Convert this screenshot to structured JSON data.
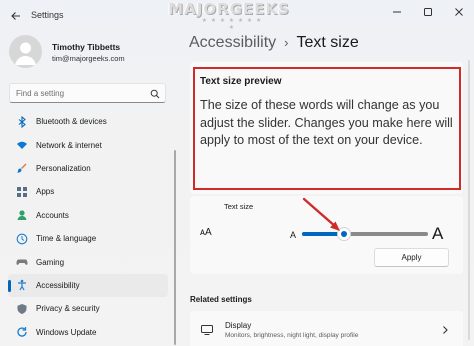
{
  "window": {
    "app_title": "Settings",
    "watermark": "MAJORGEEKS",
    "watermark_stars": "★ ★ ★ ★ ★ ★ ★ ★"
  },
  "profile": {
    "name": "Timothy Tibbetts",
    "email": "tim@majorgeeks.com"
  },
  "search": {
    "placeholder": "Find a setting"
  },
  "sidebar": {
    "items": [
      {
        "label": "Bluetooth & devices",
        "icon": "bluetooth-icon",
        "color": "#0067c0"
      },
      {
        "label": "Network & internet",
        "icon": "wifi-icon",
        "color": "#0a78d4"
      },
      {
        "label": "Personalization",
        "icon": "brush-icon",
        "color": "#e5793d"
      },
      {
        "label": "Apps",
        "icon": "apps-icon",
        "color": "#5a6f86"
      },
      {
        "label": "Accounts",
        "icon": "person-icon",
        "color": "#2fa06b"
      },
      {
        "label": "Time & language",
        "icon": "globe-clock-icon",
        "color": "#1c7fd0"
      },
      {
        "label": "Gaming",
        "icon": "gamepad-icon",
        "color": "#7a7a7a"
      },
      {
        "label": "Accessibility",
        "icon": "accessibility-icon",
        "color": "#1c7fd0",
        "active": true
      },
      {
        "label": "Privacy & security",
        "icon": "shield-icon",
        "color": "#6e7a88"
      },
      {
        "label": "Windows Update",
        "icon": "update-icon",
        "color": "#1c7fd0"
      }
    ]
  },
  "breadcrumb": {
    "parent": "Accessibility",
    "separator": "›",
    "current": "Text size"
  },
  "preview": {
    "title": "Text size preview",
    "text": "The size of these words will change as you adjust the slider. Changes you make here will apply to most of the text on your device."
  },
  "text_size": {
    "label": "Text size",
    "icon_glyph": "ᴀA",
    "small_a": "A",
    "large_a": "A",
    "slider_fraction": 0.33,
    "apply_label": "Apply"
  },
  "related": {
    "heading": "Related settings",
    "display_title": "Display",
    "display_desc": "Monitors, brightness, night light, display profile"
  },
  "colors": {
    "accent": "#0067c0",
    "highlight_box": "#d02b2b",
    "annotation_arrow": "#d02b2b"
  }
}
